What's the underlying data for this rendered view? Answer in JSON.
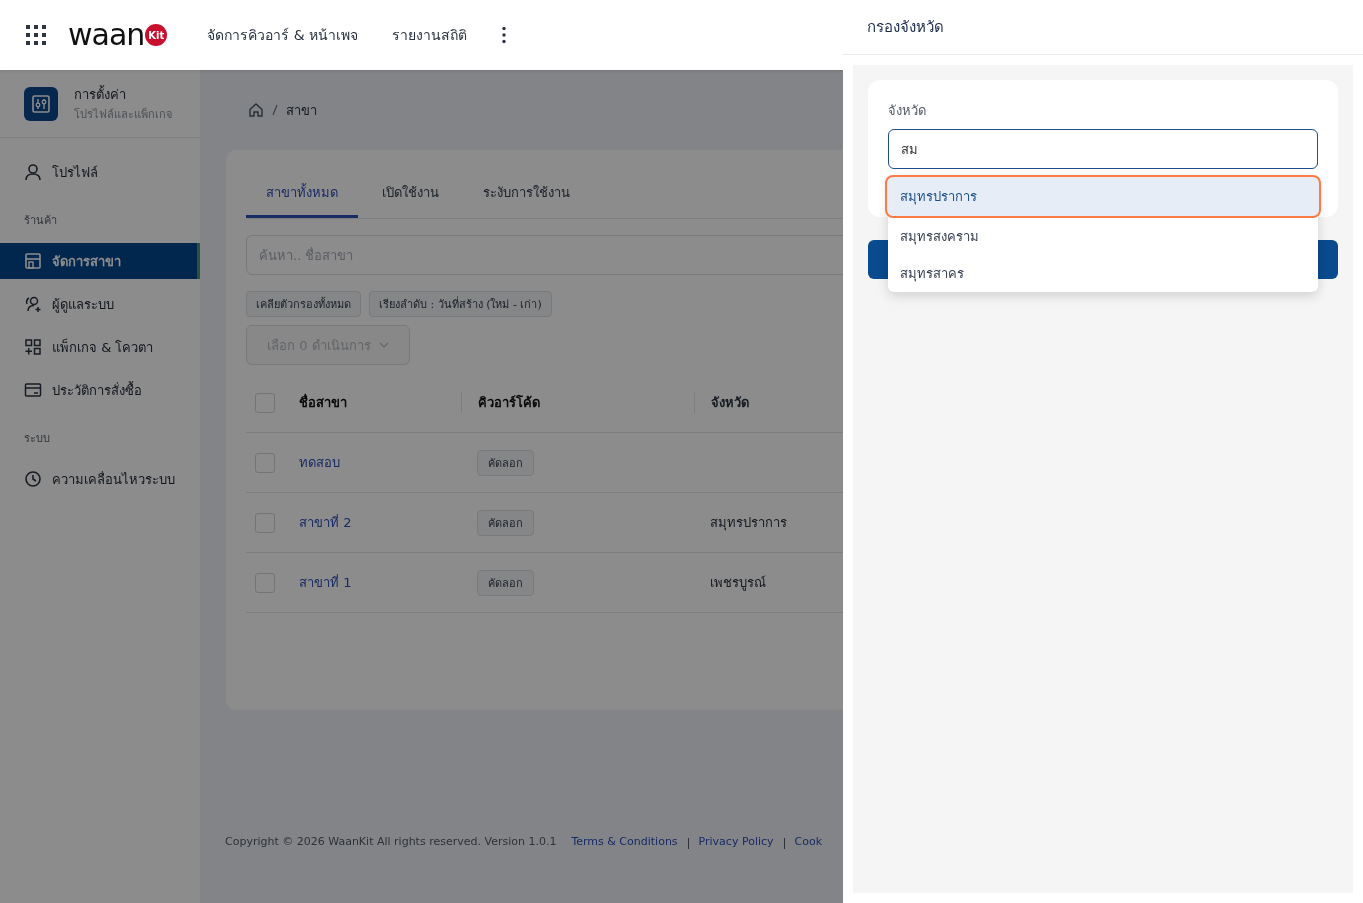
{
  "header": {
    "logo": {
      "word": "waan",
      "badge": "Kit"
    },
    "nav": [
      "จัดการคิวอาร์ & หน้าเพจ",
      "รายงานสถิติ"
    ]
  },
  "sidebar": {
    "title": "การตั้งค่า",
    "subtitle": "โปรไฟล์และแพ็กเกจ",
    "sections": [
      {
        "items": [
          {
            "label": "โปรไฟล์",
            "selected": false
          }
        ]
      },
      {
        "title": "ร้านค้า",
        "items": [
          {
            "label": "จัดการสาขา",
            "selected": true
          },
          {
            "label": "ผู้ดูแลระบบ",
            "selected": false
          },
          {
            "label": "แพ็กเกจ & โควตา",
            "selected": false
          },
          {
            "label": "ประวัติการสั่งซื้อ",
            "selected": false
          }
        ]
      },
      {
        "title": "ระบบ",
        "items": [
          {
            "label": "ความเคลื่อนไหวระบบ",
            "selected": false
          }
        ]
      }
    ]
  },
  "breadcrumb": [
    "สาขา"
  ],
  "tabs": [
    {
      "label": "สาขาทั้งหมด",
      "selected": true
    },
    {
      "label": "เปิดใช้งาน",
      "selected": false
    },
    {
      "label": "ระงับการใช้งาน",
      "selected": false
    }
  ],
  "search": {
    "placeholder": "ค้นหา.. ชื่อสาขา"
  },
  "filters": [
    "เคลียตัวกรองทั้งหมด",
    "เรียงลำดับ : วันที่สร้าง (ใหม่ - เก่า)"
  ],
  "bulk_action": {
    "label": "เลือก 0 ดำเนินการ",
    "disabled": true
  },
  "table": {
    "select_all_checked": false,
    "columns": [
      "ชื่อสาขา",
      "คิวอาร์โค้ด",
      "จังหวัด"
    ],
    "rows": [
      {
        "name": "ทดสอบ",
        "copy": "คัดลอก",
        "checked": false
      },
      {
        "name": "สาขาที่ 2",
        "copy": "คัดลอก",
        "province": "สมุทรปราการ",
        "checked": false
      },
      {
        "name": "สาขาที่ 1",
        "copy": "คัดลอก",
        "province": "เพชรบูรณ์",
        "checked": false
      }
    ]
  },
  "footer": {
    "copyright": "Copyright © 2026 WaanKit All rights reserved. Version 1.0.1",
    "links": [
      "Terms & Conditions",
      "Privacy Policy",
      "Cook"
    ]
  },
  "drawer": {
    "title": "กรองจังหวัด",
    "field": {
      "label": "จังหวัด",
      "value": "สม"
    },
    "options": [
      {
        "label": "สมุทรปราการ",
        "selected": true
      },
      {
        "label": "สมุทรสงคราม",
        "selected": false
      },
      {
        "label": "สมุทรสาคร",
        "selected": false
      }
    ]
  }
}
